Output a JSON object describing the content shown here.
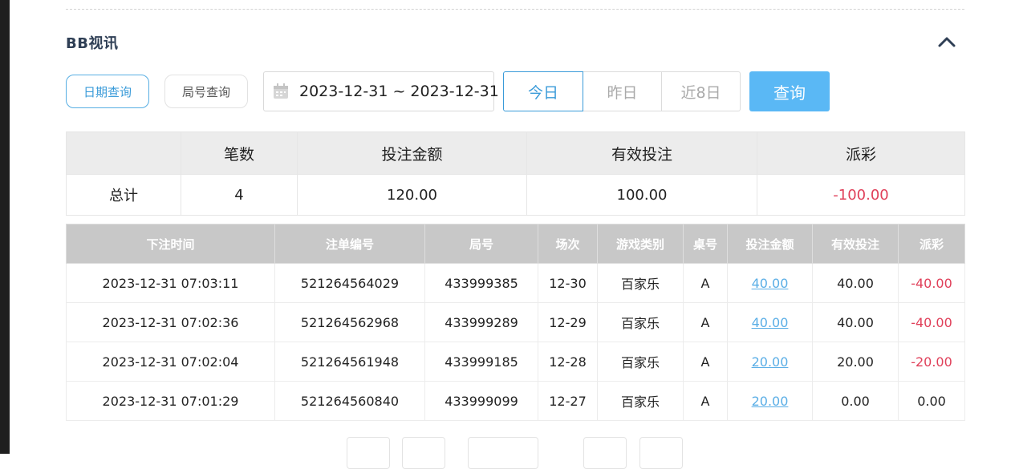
{
  "section": {
    "title": "BB视讯"
  },
  "filters": {
    "date_query_label": "日期查询",
    "round_query_label": "局号查询",
    "date_range": "2023-12-31 ~ 2023-12-31",
    "quick_today": "今日",
    "quick_yesterday": "昨日",
    "quick_8days": "近8日",
    "search_label": "查询"
  },
  "summary": {
    "headers": [
      "",
      "笔数",
      "投注金额",
      "有效投注",
      "派彩"
    ],
    "row": [
      "总计",
      "4",
      "120.00",
      "100.00",
      "-100.00"
    ]
  },
  "detail": {
    "headers": [
      "下注时间",
      "注单编号",
      "局号",
      "场次",
      "游戏类别",
      "桌号",
      "投注金额",
      "有效投注",
      "派彩"
    ],
    "rows": [
      [
        "2023-12-31 07:03:11",
        "521264564029",
        "433999385",
        "12-30",
        "百家乐",
        "A",
        "40.00",
        "40.00",
        "-40.00"
      ],
      [
        "2023-12-31 07:02:36",
        "521264562968",
        "433999289",
        "12-29",
        "百家乐",
        "A",
        "40.00",
        "40.00",
        "-40.00"
      ],
      [
        "2023-12-31 07:02:04",
        "521264561948",
        "433999185",
        "12-28",
        "百家乐",
        "A",
        "20.00",
        "20.00",
        "-20.00"
      ],
      [
        "2023-12-31 07:01:29",
        "521264560840",
        "433999099",
        "12-27",
        "百家乐",
        "A",
        "20.00",
        "0.00",
        "0.00"
      ]
    ]
  },
  "colors": {
    "accent": "#3a9bd9",
    "search_button": "#5ab8f5",
    "negative": "#e0405a",
    "header_bg": "#c8c8c8"
  }
}
